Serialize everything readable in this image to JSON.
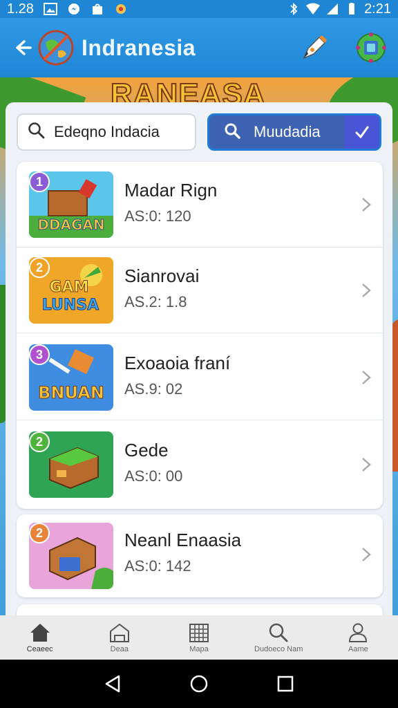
{
  "status_bar": {
    "left_text": "1.28",
    "time": "2:21"
  },
  "app_bar": {
    "title": "Indranesia",
    "icons": [
      "back-arrow-icon",
      "globe-logo-icon",
      "pen-icon",
      "profile-icon"
    ]
  },
  "banner": {
    "text": "RANEASA"
  },
  "search": {
    "value": "Edeqno Indacia"
  },
  "filter_button": {
    "label": "Muudadia"
  },
  "list": [
    {
      "badge": "1",
      "badge_color": "#8b5cd6",
      "title": "Madar Rign",
      "subtitle": "AS:0: 120",
      "thumb_text": "DDAGAN"
    },
    {
      "badge": "2",
      "badge_color": "#f0a126",
      "title": "Sianrovai",
      "subtitle": "AS.2: 1.8",
      "thumb_text": "GAM LUNSA"
    },
    {
      "badge": "3",
      "badge_color": "#b04fd0",
      "title": "Exoaoia franí",
      "subtitle": "AS.9: 02",
      "thumb_text": "BNUAN"
    },
    {
      "badge": "2",
      "badge_color": "#4fb43c",
      "title": "Gede",
      "subtitle": "AS:0: 00",
      "thumb_text": ""
    },
    {
      "badge": "2",
      "badge_color": "#e8843a",
      "title": "Neanl Enaasia",
      "subtitle": "AS:0: 142",
      "thumb_text": ""
    }
  ],
  "bottom_nav": [
    {
      "label": "Ceaeec",
      "icon": "home-icon"
    },
    {
      "label": "Deaa",
      "icon": "store-icon"
    },
    {
      "label": "Mapa",
      "icon": "calendar-icon"
    },
    {
      "label": "Dudoeco Nam",
      "icon": "search-icon"
    },
    {
      "label": "Aame",
      "icon": "user-icon"
    }
  ],
  "colors": {
    "app_bar": "#1f86d6",
    "filter_button": "#3f63b3",
    "accent": "#4a55d6"
  }
}
